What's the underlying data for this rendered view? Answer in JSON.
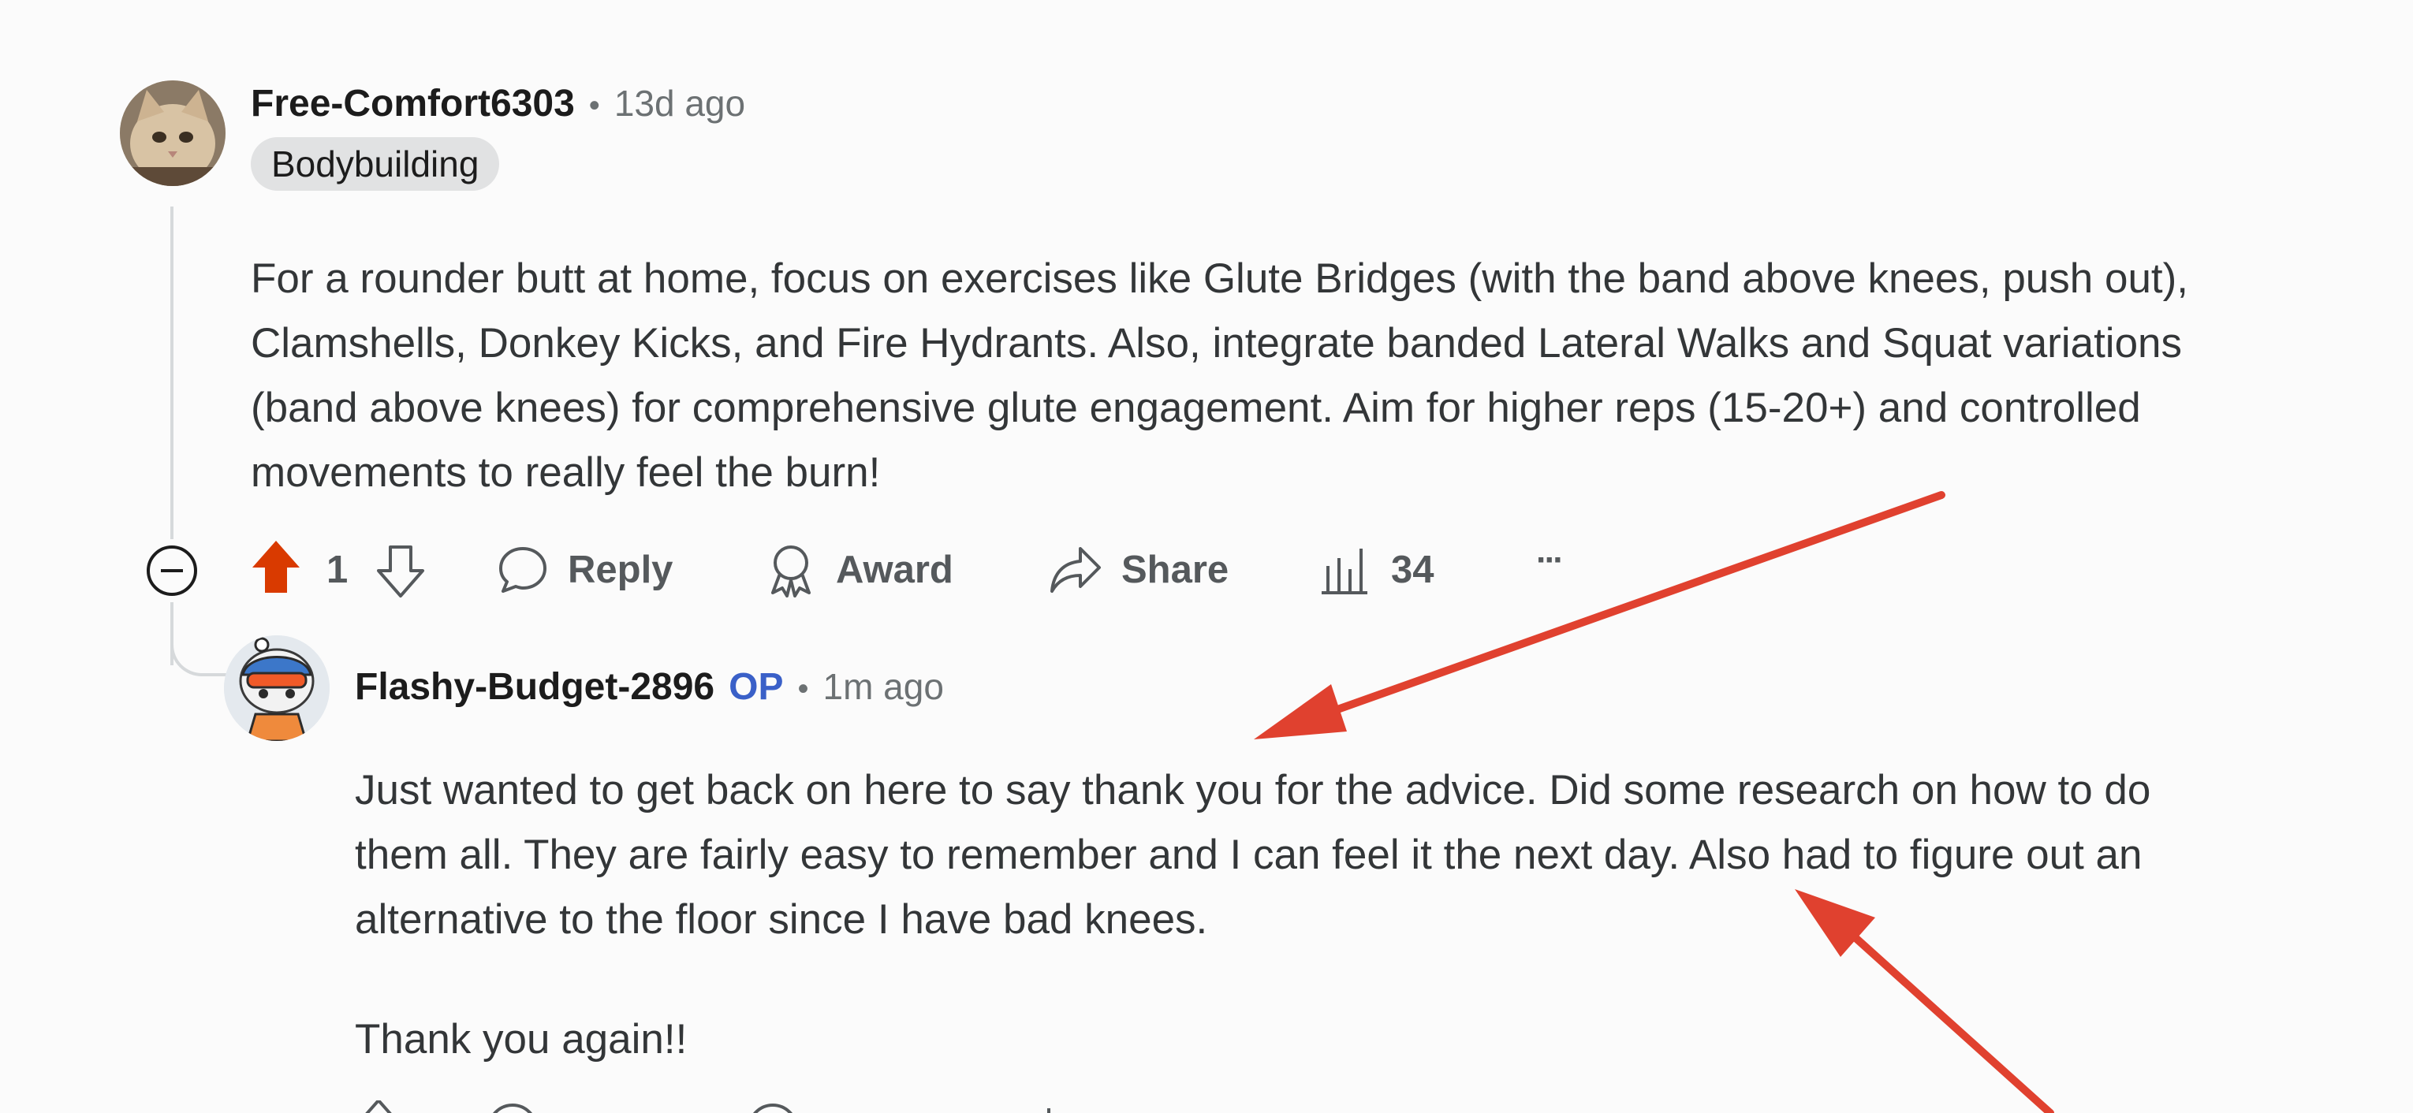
{
  "comment": {
    "username": "Free-Comfort6303",
    "separator": "•",
    "time": "13d ago",
    "flair": "Bodybuilding",
    "body_lines": [
      "For a rounder butt at home, focus on exercises like Glute Bridges (with the band above knees, push out),",
      "Clamshells, Donkey Kicks, and Fire Hydrants. Also, integrate banded Lateral Walks and Squat variations",
      "(band above knees) for comprehensive glute engagement. Aim for higher reps (15-20+) and controlled",
      "movements to really feel the burn!"
    ],
    "actions": {
      "vote_count": "1",
      "reply_label": "Reply",
      "award_label": "Award",
      "share_label": "Share",
      "views_count": "34",
      "more_label": "···"
    }
  },
  "reply": {
    "username": "Flashy-Budget-2896",
    "op_tag": "OP",
    "separator": "•",
    "time": "1m ago",
    "body_lines": [
      "Just wanted to get back on here to say thank you for the advice. Did some research on how to do",
      "them all. They are fairly easy to remember and I can feel it the next day. Also had to figure out an",
      "alternative to the floor since I have bad knees."
    ],
    "closing": "Thank you again!!"
  },
  "colors": {
    "upvote_active": "#d93a00",
    "annotation_arrow": "#e0412f",
    "op_blue": "#3a60c8",
    "meta_gray": "#6c7173"
  },
  "icons": [
    "collapse-icon",
    "upvote-icon",
    "downvote-icon",
    "reply-icon",
    "award-icon",
    "share-icon",
    "views-icon",
    "more-icon"
  ]
}
